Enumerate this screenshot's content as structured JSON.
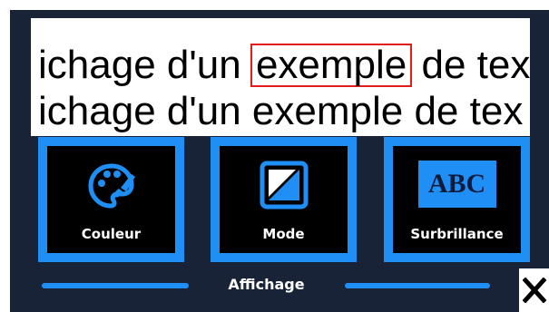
{
  "preview": {
    "line1_before": "ichage d'un",
    "line1_highlight": "exemple",
    "line1_after": "de tex",
    "line2": "ichage d'un exemple de tex"
  },
  "tiles": [
    {
      "label": "Couleur",
      "icon": "palette-icon"
    },
    {
      "label": "Mode",
      "icon": "contrast-icon"
    },
    {
      "label": "Surbrillance",
      "icon": "abc-highlight-icon",
      "icon_text": "ABC"
    }
  ],
  "footer": {
    "title": "Affichage",
    "close_icon": "close-icon"
  },
  "colors": {
    "background": "#192337",
    "accent": "#1f8ef5",
    "highlight_border": "#e31b1b",
    "tile_inner": "#000000"
  }
}
